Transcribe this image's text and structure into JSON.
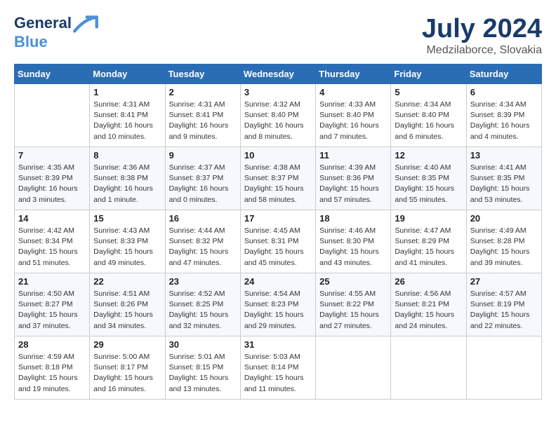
{
  "header": {
    "logo_line1": "General",
    "logo_line2": "Blue",
    "month": "July 2024",
    "location": "Medzilaborce, Slovakia"
  },
  "days_of_week": [
    "Sunday",
    "Monday",
    "Tuesday",
    "Wednesday",
    "Thursday",
    "Friday",
    "Saturday"
  ],
  "weeks": [
    [
      {
        "day": "",
        "sunrise": "",
        "sunset": "",
        "daylight": ""
      },
      {
        "day": "1",
        "sunrise": "Sunrise: 4:31 AM",
        "sunset": "Sunset: 8:41 PM",
        "daylight": "Daylight: 16 hours and 10 minutes."
      },
      {
        "day": "2",
        "sunrise": "Sunrise: 4:31 AM",
        "sunset": "Sunset: 8:41 PM",
        "daylight": "Daylight: 16 hours and 9 minutes."
      },
      {
        "day": "3",
        "sunrise": "Sunrise: 4:32 AM",
        "sunset": "Sunset: 8:40 PM",
        "daylight": "Daylight: 16 hours and 8 minutes."
      },
      {
        "day": "4",
        "sunrise": "Sunrise: 4:33 AM",
        "sunset": "Sunset: 8:40 PM",
        "daylight": "Daylight: 16 hours and 7 minutes."
      },
      {
        "day": "5",
        "sunrise": "Sunrise: 4:34 AM",
        "sunset": "Sunset: 8:40 PM",
        "daylight": "Daylight: 16 hours and 6 minutes."
      },
      {
        "day": "6",
        "sunrise": "Sunrise: 4:34 AM",
        "sunset": "Sunset: 8:39 PM",
        "daylight": "Daylight: 16 hours and 4 minutes."
      }
    ],
    [
      {
        "day": "7",
        "sunrise": "Sunrise: 4:35 AM",
        "sunset": "Sunset: 8:39 PM",
        "daylight": "Daylight: 16 hours and 3 minutes."
      },
      {
        "day": "8",
        "sunrise": "Sunrise: 4:36 AM",
        "sunset": "Sunset: 8:38 PM",
        "daylight": "Daylight: 16 hours and 1 minute."
      },
      {
        "day": "9",
        "sunrise": "Sunrise: 4:37 AM",
        "sunset": "Sunset: 8:37 PM",
        "daylight": "Daylight: 16 hours and 0 minutes."
      },
      {
        "day": "10",
        "sunrise": "Sunrise: 4:38 AM",
        "sunset": "Sunset: 8:37 PM",
        "daylight": "Daylight: 15 hours and 58 minutes."
      },
      {
        "day": "11",
        "sunrise": "Sunrise: 4:39 AM",
        "sunset": "Sunset: 8:36 PM",
        "daylight": "Daylight: 15 hours and 57 minutes."
      },
      {
        "day": "12",
        "sunrise": "Sunrise: 4:40 AM",
        "sunset": "Sunset: 8:35 PM",
        "daylight": "Daylight: 15 hours and 55 minutes."
      },
      {
        "day": "13",
        "sunrise": "Sunrise: 4:41 AM",
        "sunset": "Sunset: 8:35 PM",
        "daylight": "Daylight: 15 hours and 53 minutes."
      }
    ],
    [
      {
        "day": "14",
        "sunrise": "Sunrise: 4:42 AM",
        "sunset": "Sunset: 8:34 PM",
        "daylight": "Daylight: 15 hours and 51 minutes."
      },
      {
        "day": "15",
        "sunrise": "Sunrise: 4:43 AM",
        "sunset": "Sunset: 8:33 PM",
        "daylight": "Daylight: 15 hours and 49 minutes."
      },
      {
        "day": "16",
        "sunrise": "Sunrise: 4:44 AM",
        "sunset": "Sunset: 8:32 PM",
        "daylight": "Daylight: 15 hours and 47 minutes."
      },
      {
        "day": "17",
        "sunrise": "Sunrise: 4:45 AM",
        "sunset": "Sunset: 8:31 PM",
        "daylight": "Daylight: 15 hours and 45 minutes."
      },
      {
        "day": "18",
        "sunrise": "Sunrise: 4:46 AM",
        "sunset": "Sunset: 8:30 PM",
        "daylight": "Daylight: 15 hours and 43 minutes."
      },
      {
        "day": "19",
        "sunrise": "Sunrise: 4:47 AM",
        "sunset": "Sunset: 8:29 PM",
        "daylight": "Daylight: 15 hours and 41 minutes."
      },
      {
        "day": "20",
        "sunrise": "Sunrise: 4:49 AM",
        "sunset": "Sunset: 8:28 PM",
        "daylight": "Daylight: 15 hours and 39 minutes."
      }
    ],
    [
      {
        "day": "21",
        "sunrise": "Sunrise: 4:50 AM",
        "sunset": "Sunset: 8:27 PM",
        "daylight": "Daylight: 15 hours and 37 minutes."
      },
      {
        "day": "22",
        "sunrise": "Sunrise: 4:51 AM",
        "sunset": "Sunset: 8:26 PM",
        "daylight": "Daylight: 15 hours and 34 minutes."
      },
      {
        "day": "23",
        "sunrise": "Sunrise: 4:52 AM",
        "sunset": "Sunset: 8:25 PM",
        "daylight": "Daylight: 15 hours and 32 minutes."
      },
      {
        "day": "24",
        "sunrise": "Sunrise: 4:54 AM",
        "sunset": "Sunset: 8:23 PM",
        "daylight": "Daylight: 15 hours and 29 minutes."
      },
      {
        "day": "25",
        "sunrise": "Sunrise: 4:55 AM",
        "sunset": "Sunset: 8:22 PM",
        "daylight": "Daylight: 15 hours and 27 minutes."
      },
      {
        "day": "26",
        "sunrise": "Sunrise: 4:56 AM",
        "sunset": "Sunset: 8:21 PM",
        "daylight": "Daylight: 15 hours and 24 minutes."
      },
      {
        "day": "27",
        "sunrise": "Sunrise: 4:57 AM",
        "sunset": "Sunset: 8:19 PM",
        "daylight": "Daylight: 15 hours and 22 minutes."
      }
    ],
    [
      {
        "day": "28",
        "sunrise": "Sunrise: 4:59 AM",
        "sunset": "Sunset: 8:18 PM",
        "daylight": "Daylight: 15 hours and 19 minutes."
      },
      {
        "day": "29",
        "sunrise": "Sunrise: 5:00 AM",
        "sunset": "Sunset: 8:17 PM",
        "daylight": "Daylight: 15 hours and 16 minutes."
      },
      {
        "day": "30",
        "sunrise": "Sunrise: 5:01 AM",
        "sunset": "Sunset: 8:15 PM",
        "daylight": "Daylight: 15 hours and 13 minutes."
      },
      {
        "day": "31",
        "sunrise": "Sunrise: 5:03 AM",
        "sunset": "Sunset: 8:14 PM",
        "daylight": "Daylight: 15 hours and 11 minutes."
      },
      {
        "day": "",
        "sunrise": "",
        "sunset": "",
        "daylight": ""
      },
      {
        "day": "",
        "sunrise": "",
        "sunset": "",
        "daylight": ""
      },
      {
        "day": "",
        "sunrise": "",
        "sunset": "",
        "daylight": ""
      }
    ]
  ]
}
